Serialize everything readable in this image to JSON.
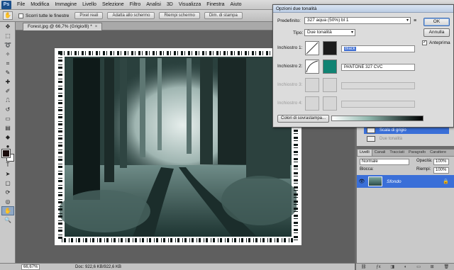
{
  "app": {
    "logo": "Ps"
  },
  "menu": [
    "File",
    "Modifica",
    "Immagine",
    "Livello",
    "Selezione",
    "Filtro",
    "Analisi",
    "3D",
    "Visualizza",
    "Finestra",
    "Aiuto"
  ],
  "options_bar": {
    "scroll_all_label": "Scorri tutte le finestre",
    "buttons": [
      "Pixel reali",
      "Adatta allo schermo",
      "Riempi schermo",
      "Dim. di stampa"
    ]
  },
  "document": {
    "tab_title": "Forest.jpg @ 66,7% (Grigio/8) *",
    "close": "×"
  },
  "status": {
    "zoom": "66,67%",
    "doc_size": "Doc: 922,6 KB/922,6 KB"
  },
  "dialog": {
    "title": "Opzioni due tonalità",
    "preset_label": "Predefinito:",
    "preset_value": "327 aqua (50%) bl 1",
    "type_label": "Tipo:",
    "type_value": "Due tonalità",
    "ink1_label": "Inchiostro 1:",
    "ink1_name": "Black",
    "ink1_color": "#1b1b1b",
    "ink2_label": "Inchiostro 2:",
    "ink2_name": "PANTONE 327 CVC",
    "ink2_color": "#108373",
    "ink3_label": "Inchiostro 3:",
    "ink4_label": "Inchiostro 4:",
    "ok": "OK",
    "cancel": "Annulla",
    "preview_label": "Anteprima",
    "overprint": "Colori di sovrastampa..."
  },
  "history": {
    "items": [
      "Scala di grigio",
      "Due tonalità"
    ]
  },
  "layers_panel": {
    "tabs": [
      "Livelli",
      "Canali",
      "Tracciati",
      "Paragrafo",
      "Carattere"
    ],
    "blend_mode": "Normale",
    "opacity_label": "Opacità:",
    "opacity_value": "100%",
    "lock_label": "Blocca:",
    "fill_label": "Riempi:",
    "fill_value": "100%",
    "layer_name": "Sfondo"
  }
}
